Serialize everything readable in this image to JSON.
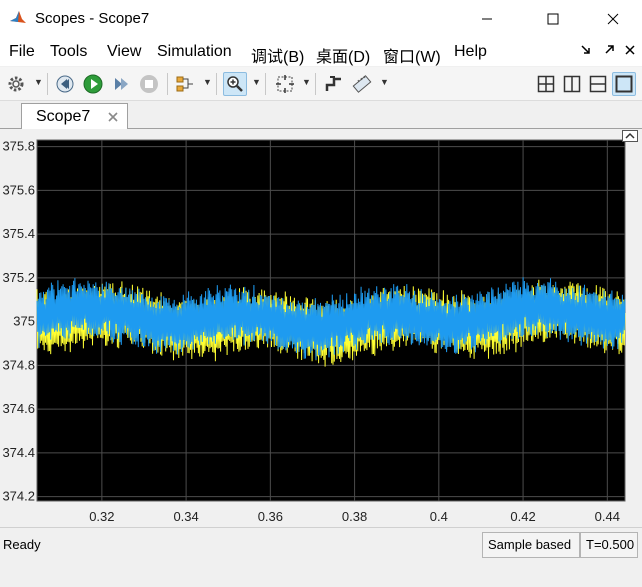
{
  "window": {
    "title": "Scopes - Scope7",
    "app_icon": "matlab-icon"
  },
  "menu": {
    "items": [
      "File",
      "Tools",
      "View",
      "Simulation",
      "调试(B)",
      "桌面(D)",
      "窗口(W)",
      "Help"
    ],
    "controls": [
      "dock-arrow-icon",
      "undock-arrow-icon",
      "close-icon"
    ]
  },
  "toolbar": {
    "icons": [
      "settings-gear-icon",
      "step-back-icon",
      "run-icon",
      "step-forward-icon",
      "stop-icon",
      "signal-select-icon",
      "zoom-in-icon",
      "autoscale-icon",
      "restore-view-icon",
      "measurement-icon",
      "layout-grid-icon",
      "layout-columns-icon",
      "layout-rows-icon",
      "layout-single-icon"
    ]
  },
  "tabs": [
    {
      "label": "Scope7"
    }
  ],
  "chart_data": {
    "type": "line",
    "xlabel": "",
    "ylabel": "",
    "xlim": [
      0.3046,
      0.4442
    ],
    "ylim": [
      374.18,
      375.83
    ],
    "xticks": [
      "0.32",
      "0.34",
      "0.36",
      "0.38",
      "0.4",
      "0.42",
      "0.44"
    ],
    "xtick_values": [
      0.32,
      0.34,
      0.36,
      0.38,
      0.4,
      0.42,
      0.44
    ],
    "yticks": [
      "374.2",
      "374.4",
      "374.6",
      "374.8",
      "375",
      "375.2",
      "375.4",
      "375.6",
      "375.8"
    ],
    "ytick_values": [
      374.2,
      374.4,
      374.6,
      374.8,
      375.0,
      375.2,
      375.4,
      375.6,
      375.8
    ],
    "grid": true,
    "background": "#000000",
    "series": [
      {
        "color": "#ffff33",
        "center": 375.0,
        "amplitude": 0.13
      },
      {
        "color": "#1e9bf0",
        "center": 375.02,
        "amplitude": 0.12
      }
    ]
  },
  "status": {
    "left": "Ready",
    "mode": "Sample based",
    "time": "T=0.500"
  }
}
